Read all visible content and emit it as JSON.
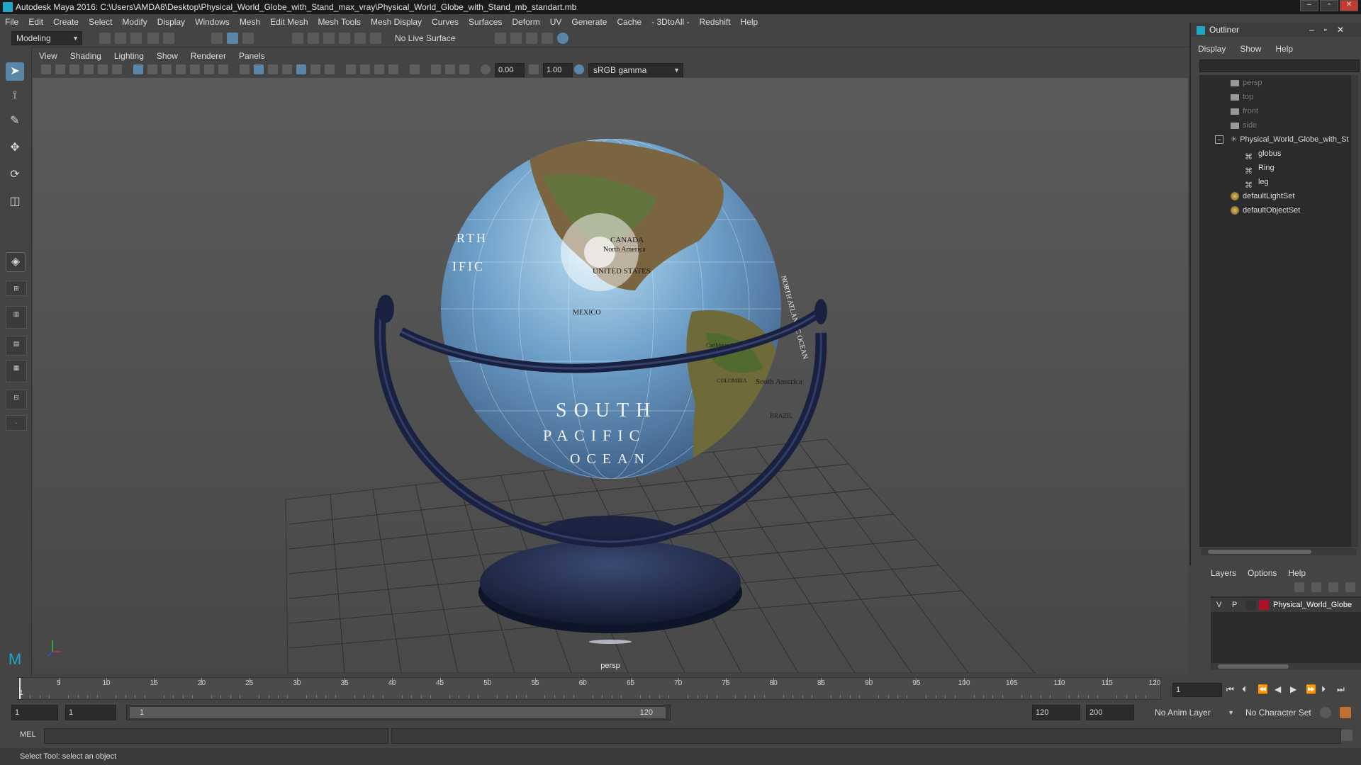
{
  "window": {
    "title": "Autodesk Maya 2016: C:\\Users\\AMDA8\\Desktop\\Physical_World_Globe_with_Stand_max_vray\\Physical_World_Globe_with_Stand_mb_standart.mb"
  },
  "menubar": [
    "File",
    "Edit",
    "Create",
    "Select",
    "Modify",
    "Display",
    "Windows",
    "Mesh",
    "Edit Mesh",
    "Mesh Tools",
    "Mesh Display",
    "Curves",
    "Surfaces",
    "Deform",
    "UV",
    "Generate",
    "Cache",
    "- 3DtoAll -",
    "Redshift",
    "Help"
  ],
  "shelf": {
    "mode": "Modeling",
    "live_surface": "No Live Surface"
  },
  "viewport": {
    "menu": [
      "View",
      "Shading",
      "Lighting",
      "Show",
      "Renderer",
      "Panels"
    ],
    "exposure": "0.00",
    "gamma": "1.00",
    "color_space": "sRGB gamma",
    "camera_label": "persp",
    "globe_text": {
      "canada": "CANADA",
      "north_america": "North America",
      "usa": "UNITED STATES",
      "mexico": "MEXICO",
      "south_america": "South America",
      "colombia": "COLOMBIA",
      "brazil": "BRAZIL",
      "south": "SOUTH",
      "pacific": "PACIFIC",
      "ocean": "OCEAN",
      "north_pacific_left": "RTH",
      "pacific_left": "IFIC",
      "north_atlantic": "NORTH ATLANTIC OCEAN",
      "caribbean": "Caribbean Sea"
    }
  },
  "outliner": {
    "title": "Outliner",
    "menu": [
      "Display",
      "Show",
      "Help"
    ],
    "items": [
      {
        "label": "persp",
        "type": "camera",
        "dim": true
      },
      {
        "label": "top",
        "type": "camera",
        "dim": true
      },
      {
        "label": "front",
        "type": "camera",
        "dim": true
      },
      {
        "label": "side",
        "type": "camera",
        "dim": true
      },
      {
        "label": "Physical_World_Globe_with_St",
        "type": "group",
        "dim": false
      },
      {
        "label": "globus",
        "type": "mesh",
        "dim": false
      },
      {
        "label": "Ring",
        "type": "mesh",
        "dim": false
      },
      {
        "label": "leg",
        "type": "mesh",
        "dim": false
      },
      {
        "label": "defaultLightSet",
        "type": "set",
        "dim": false
      },
      {
        "label": "defaultObjectSet",
        "type": "set",
        "dim": false
      }
    ]
  },
  "layers": {
    "menu": [
      "Layers",
      "Options",
      "Help"
    ],
    "rows": [
      {
        "v": "V",
        "p": "P",
        "name": "Physical_World_Globe",
        "color": "#b0102a"
      }
    ]
  },
  "timeline": {
    "ticks": [
      "5",
      "10",
      "15",
      "20",
      "25",
      "30",
      "35",
      "40",
      "45",
      "50",
      "55",
      "60",
      "65",
      "70",
      "75",
      "80",
      "85",
      "90",
      "95",
      "100",
      "105",
      "110",
      "115",
      "120"
    ],
    "current_marker": "1",
    "current_frame": "1"
  },
  "range": {
    "start": "1",
    "start2": "1",
    "slider_start": "1",
    "slider_end": "120",
    "end": "120",
    "max": "200",
    "anim_layer": "No Anim Layer",
    "char_set": "No Character Set"
  },
  "command": {
    "lang": "MEL"
  },
  "help_line": "Select Tool: select an object",
  "colors": {
    "accent": "#5b86a8",
    "panel": "#444444",
    "field": "#2b2b2b",
    "layer": "#b0102a"
  }
}
